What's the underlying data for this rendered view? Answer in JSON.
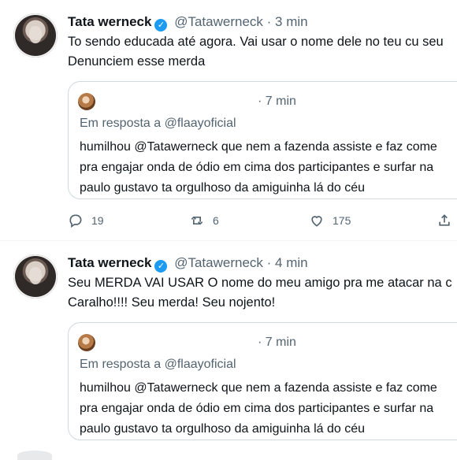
{
  "tweets": [
    {
      "name": "Tata werneck",
      "handle": "@Tatawerneck",
      "separator": "·",
      "time": "3 min",
      "text_lines": [
        "To sendo educada até agora. Vai usar o nome dele no teu cu seu",
        "Denunciem esse merda"
      ],
      "quote": {
        "time": "· 7 min",
        "reply_to": "Em resposta a @flaayoficial",
        "lines": [
          "humilhou @Tatawerneck que nem a fazenda assiste e faz come",
          "pra engajar onda de ódio em cima dos participantes e surfar na",
          "paulo gustavo ta orgulhoso da amiguinha lá do céu"
        ]
      },
      "actions": {
        "replies": "19",
        "retweets": "6",
        "likes": "175"
      }
    },
    {
      "name": "Tata werneck",
      "handle": "@Tatawerneck",
      "separator": "·",
      "time": "4 min",
      "text_lines": [
        "Seu MERDA VAI USAR O nome do meu amigo pra me atacar na c",
        "Caralho!!!! Seu merda! Seu nojento!"
      ],
      "quote": {
        "time": "· 7 min",
        "reply_to": "Em resposta a @flaayoficial",
        "lines": [
          "humilhou @Tatawerneck que nem a fazenda assiste e faz come",
          "pra engajar onda de ódio em cima dos participantes e surfar na",
          "paulo gustavo ta orgulhoso da amiguinha lá do céu"
        ]
      }
    }
  ],
  "colors": {
    "verified": "#1d9bf0",
    "secondary_text": "#536471",
    "border": "#cfd9de"
  }
}
